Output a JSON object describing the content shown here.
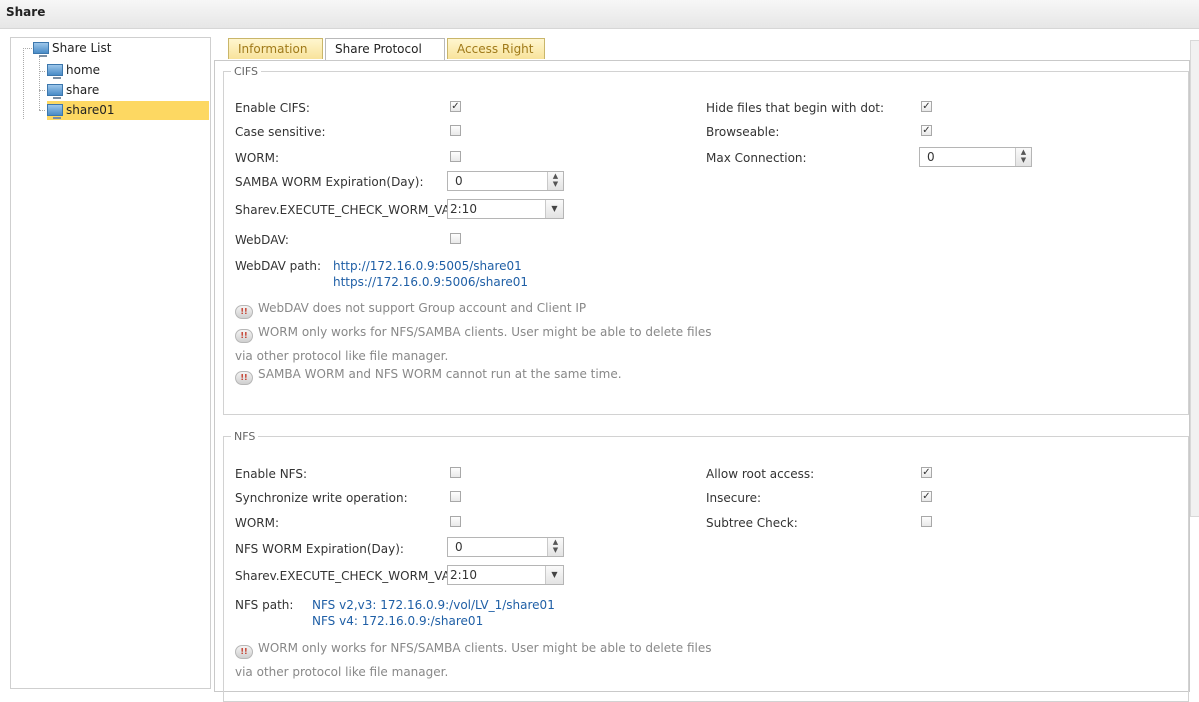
{
  "title": "Share",
  "tree": {
    "root": "Share List",
    "items": [
      "home",
      "share",
      "share01"
    ],
    "selected": "share01"
  },
  "tabs": [
    "Information",
    "Share Protocol",
    "Access Right"
  ],
  "active_tab": "Share Protocol",
  "cifs": {
    "legend": "CIFS",
    "enable_label": "Enable CIFS:",
    "enable_checked": true,
    "case_label": "Case sensitive:",
    "case_checked": false,
    "worm_label": "WORM:",
    "worm_checked": false,
    "expiration_label": "SAMBA WORM Expiration(Day):",
    "expiration_value": "0",
    "execute_label": "Sharev.EXECUTE_CHECK_WORM_VAL",
    "execute_value": "2:10",
    "webdav_label": "WebDAV:",
    "webdav_checked": false,
    "webdav_path_label": "WebDAV path:",
    "webdav_http": "http://172.16.0.9:5005/share01",
    "webdav_https": "https://172.16.0.9:5006/share01",
    "hide_dot_label": "Hide files that begin with dot:",
    "hide_dot_checked": true,
    "browseable_label": "Browseable:",
    "browseable_checked": true,
    "max_conn_label": "Max Connection:",
    "max_conn_value": "0",
    "note1": "WebDAV does not support Group account and Client IP",
    "note2": "WORM only works for NFS/SAMBA clients. User might be able to delete files",
    "note2b": "via other protocol like file manager.",
    "note3": "SAMBA WORM and NFS WORM cannot run at the same time."
  },
  "nfs": {
    "legend": "NFS",
    "enable_label": "Enable NFS:",
    "enable_checked": false,
    "sync_label": "Synchronize write operation:",
    "sync_checked": false,
    "worm_label": "WORM:",
    "worm_checked": false,
    "expiration_label": "NFS WORM Expiration(Day):",
    "expiration_value": "0",
    "execute_label": "Sharev.EXECUTE_CHECK_WORM_VAL",
    "execute_value": "2:10",
    "path_label": "NFS path:",
    "path_v23": "NFS v2,v3: 172.16.0.9:/vol/LV_1/share01",
    "path_v4": "NFS v4: 172.16.0.9:/share01",
    "root_label": "Allow root access:",
    "root_checked": true,
    "insecure_label": "Insecure:",
    "insecure_checked": true,
    "subtree_label": "Subtree Check:",
    "subtree_checked": false,
    "note1": "WORM only works for NFS/SAMBA clients. User might be able to delete files",
    "note1b": "via other protocol like file manager."
  }
}
